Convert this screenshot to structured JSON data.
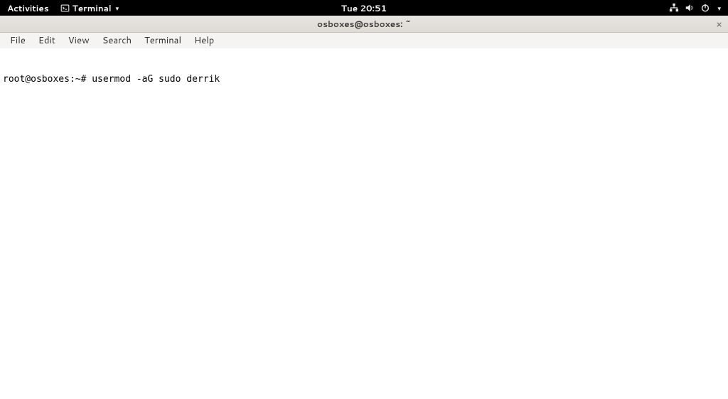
{
  "top_panel": {
    "activities": "Activities",
    "app_name": "Terminal",
    "clock": "Tue 20:51"
  },
  "window": {
    "title": "osboxes@osboxes: ~",
    "close_glyph": "×"
  },
  "menubar": {
    "items": [
      "File",
      "Edit",
      "View",
      "Search",
      "Terminal",
      "Help"
    ]
  },
  "terminal": {
    "prompt": "root@osboxes:~# ",
    "command": "usermod -aG sudo derrik"
  }
}
